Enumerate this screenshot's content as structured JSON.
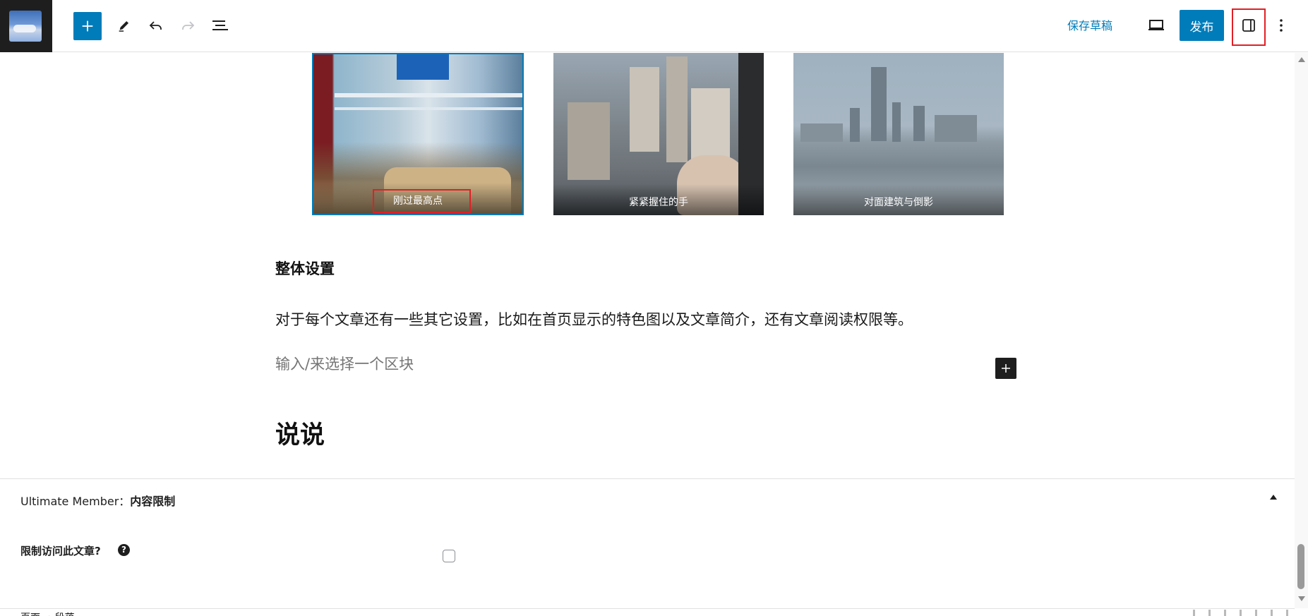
{
  "toolbar": {
    "site_icon": "site-logo-icon",
    "inserter_icon": "plus-icon",
    "tools_icon": "pencil-icon",
    "undo_icon": "undo-icon",
    "redo_icon": "redo-icon",
    "list_view_icon": "list-view-icon",
    "save_draft_label": "保存草稿",
    "preview_icon": "laptop-icon",
    "publish_label": "发布",
    "settings_icon": "sidebar-toggle-icon",
    "more_icon": "more-vertical-icon"
  },
  "gallery": {
    "images": [
      {
        "caption": "刚过最高点"
      },
      {
        "caption": "紧紧握住的手"
      },
      {
        "caption": "对面建筑与倒影"
      }
    ]
  },
  "content": {
    "heading_small": "整体设置",
    "paragraph": "对于每个文章还有一些其它设置，比如在首页显示的特色图以及文章简介，还有文章阅读权限等。",
    "block_placeholder": "输入/来选择一个区块",
    "block_add_icon": "plus-icon",
    "heading_large": "说说"
  },
  "metabox": {
    "title_prefix": "Ultimate Member：",
    "title_strong": "内容限制",
    "restrict_label": "限制访问此文章?",
    "help_icon_text": "?",
    "restrict_checked": false
  },
  "footer": {
    "breadcrumb": "页面 → 段落"
  },
  "colors": {
    "accent": "#007cba",
    "highlight": "#e11f26"
  }
}
